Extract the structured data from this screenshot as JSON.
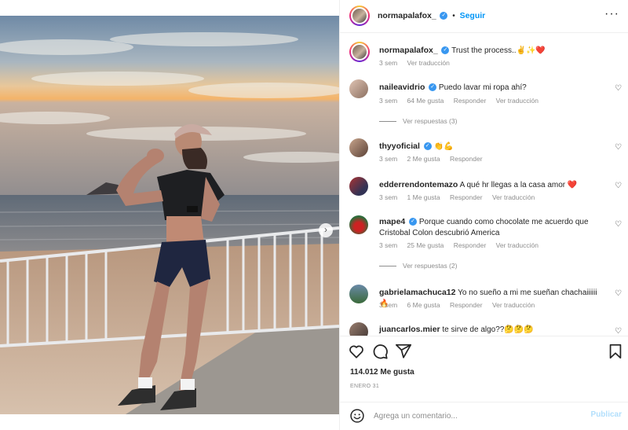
{
  "post": {
    "author": "normapalafox_",
    "follow_label": "Seguir",
    "caption_author": "normapalafox_",
    "caption_text": "Trust the process..✌️✨❤️",
    "caption_time": "3 sem",
    "caption_translate": "Ver traducción",
    "likes": "114.012 Me gusta",
    "date": "ENERO 31"
  },
  "comments": [
    {
      "user": "naileavidrio",
      "verified": true,
      "text": "Puedo lavar mi ropa ahí?",
      "time": "3 sem",
      "likes": "64 Me gusta",
      "reply": "Responder",
      "translate": "Ver traducción",
      "replies": "Ver respuestas (3)"
    },
    {
      "user": "thyyoficial",
      "verified": true,
      "text": "👏💪",
      "time": "3 sem",
      "likes": "2 Me gusta",
      "reply": "Responder"
    },
    {
      "user": "edderrendontemazo",
      "verified": false,
      "text": "A qué hr llegas a la casa amor ❤️",
      "time": "3 sem",
      "likes": "1 Me gusta",
      "reply": "Responder",
      "translate": "Ver traducción"
    },
    {
      "user": "mape4",
      "verified": true,
      "text": "Porque cuando como chocolate me acuerdo que Cristobal Colon descubrió America",
      "time": "3 sem",
      "likes": "25 Me gusta",
      "reply": "Responder",
      "translate": "Ver traducción",
      "replies": "Ver respuestas (2)"
    },
    {
      "user": "gabrielamachuca12",
      "verified": false,
      "text": "Yo no sueño a mi me sueñan chachaiiiiii🔥",
      "time": "3 sem",
      "likes": "6 Me gusta",
      "reply": "Responder",
      "translate": "Ver traducción"
    },
    {
      "user": "juancarlos.mier",
      "verified": false,
      "text": "te sirve de algo??🤔🤔🤔"
    }
  ],
  "add_comment": {
    "placeholder": "Agrega un comentario...",
    "publish": "Publicar"
  },
  "icons": {
    "more": "more-options-icon",
    "like": "heart-icon",
    "comment": "comment-icon",
    "share": "share-icon",
    "save": "bookmark-icon",
    "emoji": "emoji-icon",
    "next": "chevron-right-icon"
  },
  "colors": {
    "link": "#0095f6",
    "verified": "#3897f0",
    "muted": "#8e8e8e",
    "publish_disabled": "#b2dffc",
    "heart_red": "#ed4956"
  }
}
